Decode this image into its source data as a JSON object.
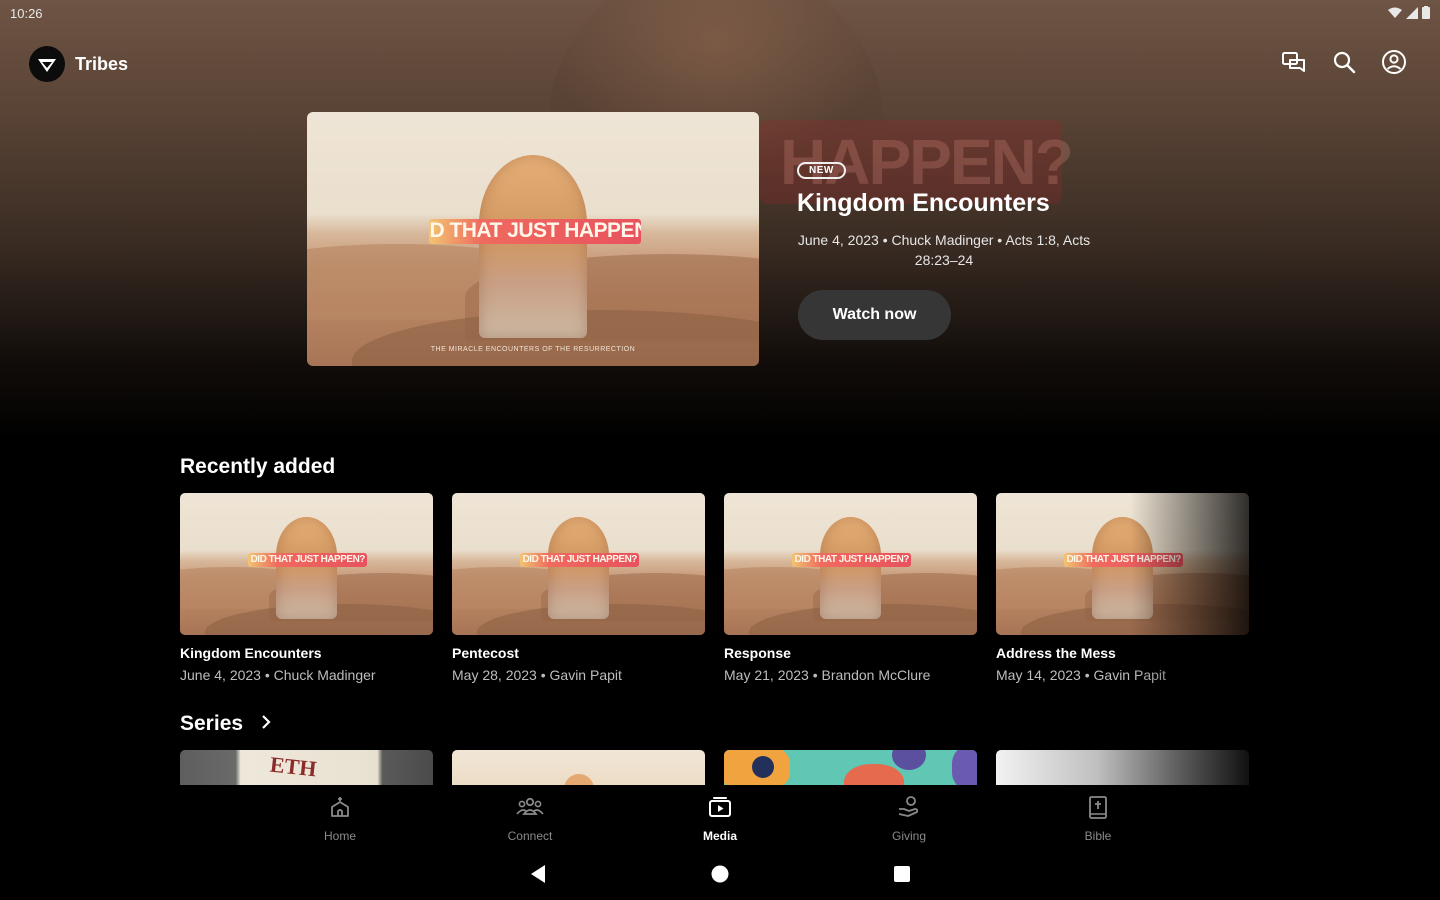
{
  "status_bar": {
    "time": "10:26"
  },
  "app": {
    "title": "Tribes"
  },
  "top_actions": [
    {
      "name": "messages",
      "icon": "chat-bubbles-icon"
    },
    {
      "name": "search",
      "icon": "search-icon"
    },
    {
      "name": "account",
      "icon": "account-circle-icon"
    }
  ],
  "hero": {
    "badge": "NEW",
    "title": "Kingdom Encounters",
    "meta": "June 4, 2023 • Chuck Madinger • Acts 1:8, Acts 28:23–24",
    "button_label": "Watch now",
    "art_text": "DID THAT JUST HAPPEN?",
    "art_caption": "THE MIRACLE ENCOUNTERS OF THE RESURRECTION",
    "background_art_text": "HAPPEN?"
  },
  "recently_added": {
    "title": "Recently added",
    "items": [
      {
        "title": "Kingdom Encounters",
        "meta": "June 4, 2023 • Chuck Madinger",
        "art_text": "DID THAT JUST HAPPEN?"
      },
      {
        "title": "Pentecost",
        "meta": "May 28, 2023 • Gavin Papit",
        "art_text": "DID THAT JUST HAPPEN?"
      },
      {
        "title": "Response",
        "meta": "May 21, 2023 • Brandon McClure",
        "art_text": "DID THAT JUST HAPPEN?"
      },
      {
        "title": "Address the Mess",
        "meta": "May 14, 2023 • Gavin Papit",
        "art_text": "DID THAT JUST HAPPEN?"
      }
    ]
  },
  "series": {
    "title": "Series",
    "chevron_icon": "chevron-right-icon",
    "first_card_text": "ETH"
  },
  "bottom_nav": {
    "active": "Media",
    "items": [
      {
        "label": "Home",
        "icon": "church-home-icon"
      },
      {
        "label": "Connect",
        "icon": "people-group-icon"
      },
      {
        "label": "Media",
        "icon": "media-play-icon"
      },
      {
        "label": "Giving",
        "icon": "giving-hand-icon"
      },
      {
        "label": "Bible",
        "icon": "bible-book-icon"
      }
    ]
  },
  "system_nav": [
    {
      "name": "back",
      "icon": "back-triangle-icon"
    },
    {
      "name": "home",
      "icon": "home-circle-icon"
    },
    {
      "name": "recents",
      "icon": "recents-square-icon"
    }
  ],
  "colors": {
    "background": "#000000",
    "hero_gradient_top": "#6e5444",
    "button_bg": "#363636",
    "banner_red": "#e8525e",
    "banner_orange": "#f3c56f",
    "muted_text": "#bdbdbd"
  }
}
